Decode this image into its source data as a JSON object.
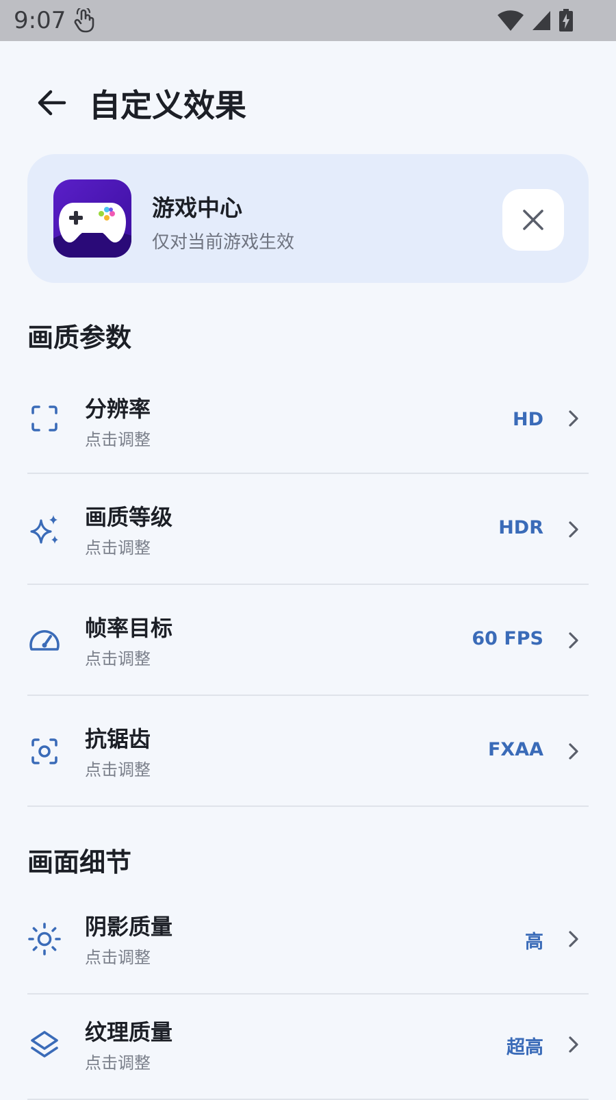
{
  "status_bar": {
    "time": "9:07"
  },
  "header": {
    "title": "自定义效果"
  },
  "game_card": {
    "name": "游戏中心",
    "subtitle": "仅对当前游戏生效"
  },
  "sections": [
    {
      "title": "画质参数",
      "items": [
        {
          "label": "分辨率",
          "hint": "点击调整",
          "value": "HD",
          "icon": "fullscreen-frame-icon"
        },
        {
          "label": "画质等级",
          "hint": "点击调整",
          "value": "HDR",
          "icon": "sparkles-icon"
        },
        {
          "label": "帧率目标",
          "hint": "点击调整",
          "value": "60 FPS",
          "icon": "speedometer-icon"
        },
        {
          "label": "抗锯齿",
          "hint": "点击调整",
          "value": "FXAA",
          "icon": "focus-target-icon"
        }
      ]
    },
    {
      "title": "画面细节",
      "items": [
        {
          "label": "阴影质量",
          "hint": "点击调整",
          "value": "高",
          "icon": "sun-icon"
        },
        {
          "label": "纹理质量",
          "hint": "点击调整",
          "value": "超高",
          "icon": "layers-icon"
        }
      ]
    }
  ],
  "colors": {
    "accent": "#3a6bb8",
    "background": "#f4f7fc",
    "card": "#e4ecfb"
  }
}
